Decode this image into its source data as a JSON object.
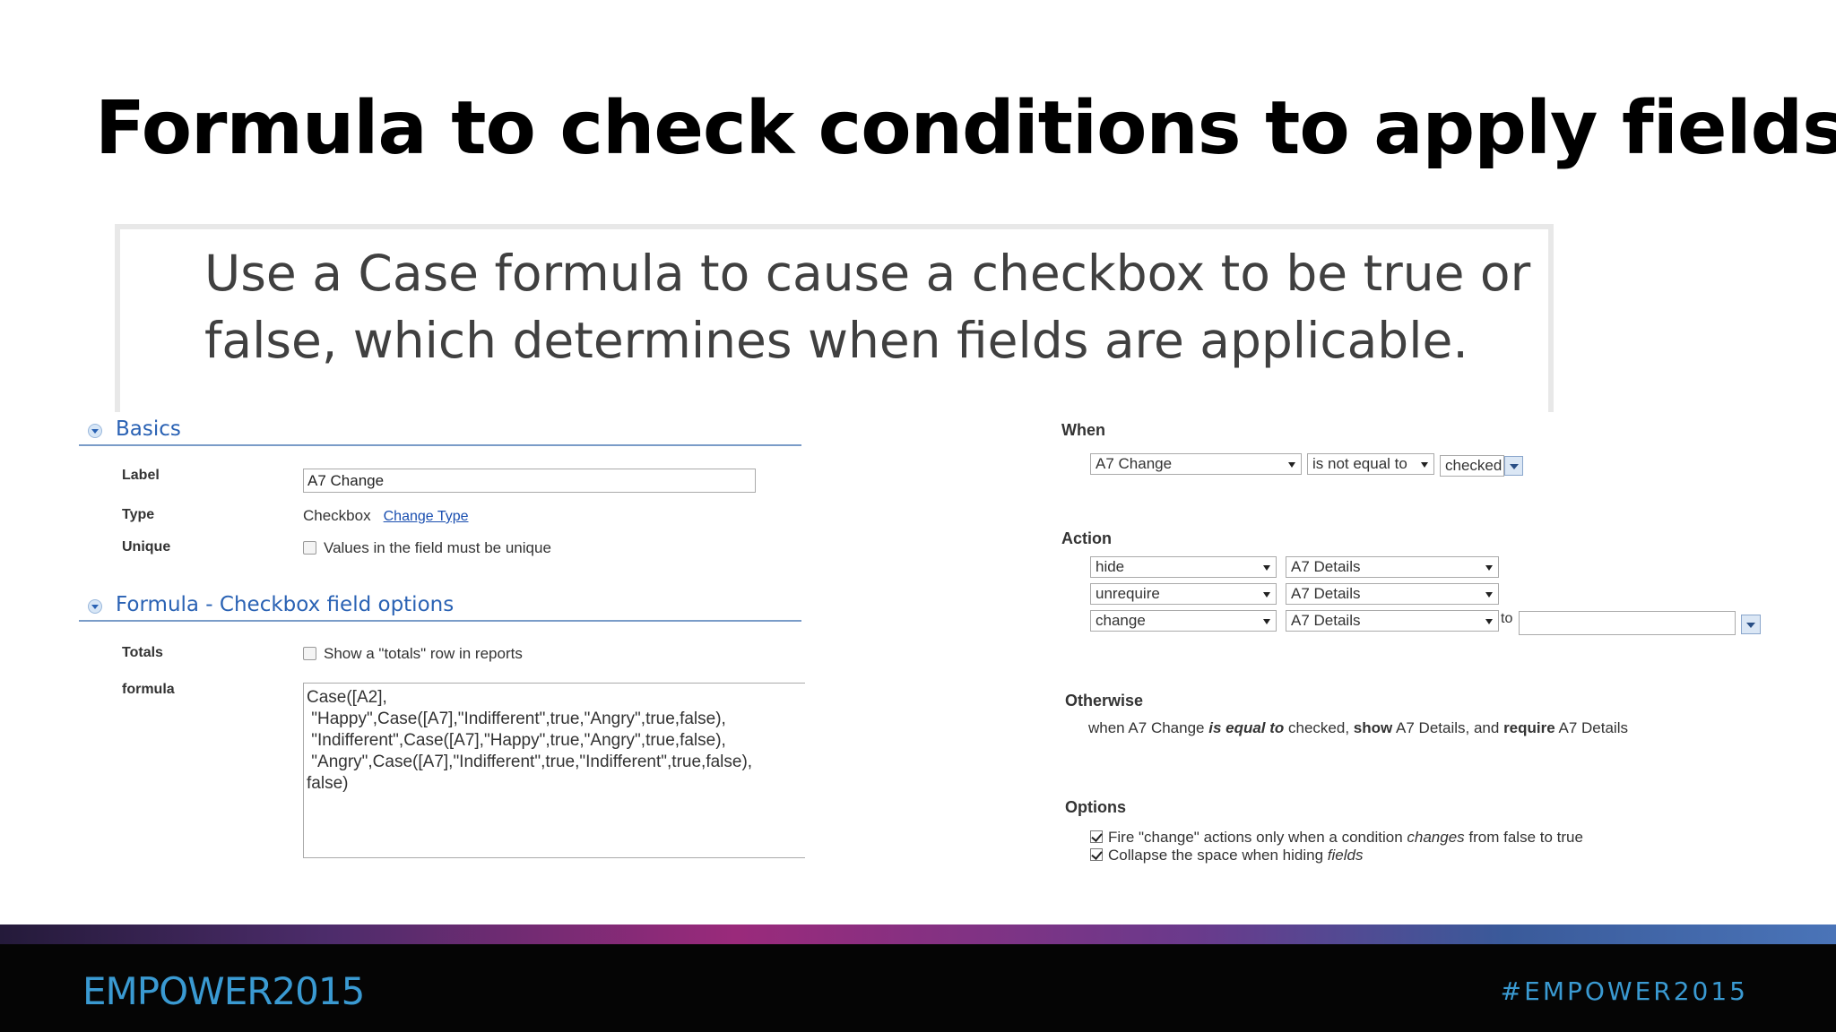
{
  "slide": {
    "title": "Formula to check conditions to apply fields",
    "callout": "Use a Case formula to cause a checkbox to be true or false, which determines when fields are applicable."
  },
  "field_editor": {
    "basics_section": "Basics",
    "label_label": "Label",
    "label_value": "A7 Change",
    "type_label": "Type",
    "type_value": "Checkbox",
    "change_type_link": "Change Type",
    "unique_label": "Unique",
    "unique_option": "Values in the field must be unique",
    "formula_section": "Formula - Checkbox field options",
    "totals_label": "Totals",
    "totals_option": "Show a \"totals\" row in reports",
    "formula_label": "formula",
    "formula_value": "Case([A2],\n \"Happy\",Case([A7],\"Indifferent\",true,\"Angry\",true,false),\n \"Indifferent\",Case([A7],\"Happy\",true,\"Angry\",true,false),\n \"Angry\",Case([A7],\"Indifferent\",true,\"Indifferent\",true,false),\nfalse)"
  },
  "rule_editor": {
    "when_heading": "When",
    "when_field": "A7 Change",
    "when_operator": "is not equal to",
    "when_value": "checked",
    "action_heading": "Action",
    "actions": [
      {
        "verb": "hide",
        "target": "A7 Details"
      },
      {
        "verb": "unrequire",
        "target": "A7 Details"
      },
      {
        "verb": "change",
        "target": "A7 Details"
      }
    ],
    "to_label": "to",
    "otherwise_heading": "Otherwise",
    "otherwise_parts": {
      "p1": "when A7 Change ",
      "p2": "is equal to",
      "p3": " checked, ",
      "p4": "show",
      "p5": " A7 Details, and ",
      "p6": "require",
      "p7": " A7 Details"
    },
    "options_heading": "Options",
    "option1": {
      "a": "Fire \"change\" actions only when a condition ",
      "b": "changes",
      "c": " from false to true"
    },
    "option2": {
      "a": "Collapse the space when hiding ",
      "b": "fields"
    }
  },
  "footer": {
    "brand": "EMPOWER2015",
    "hashtag": "#EMPOWER2015"
  },
  "colors": {
    "section_blue": "#2a62b4",
    "footer_text": "#3a9ad2",
    "footer_bg": "#050505"
  }
}
